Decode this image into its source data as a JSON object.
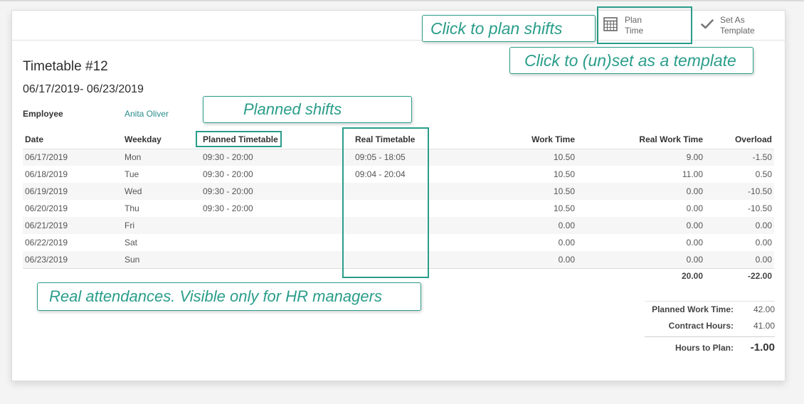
{
  "buttons": {
    "plan_time": {
      "line1": "Plan",
      "line2": "Time",
      "icon": "calendar-icon"
    },
    "set_template": {
      "line1": "Set As",
      "line2": "Template",
      "icon": "check-icon"
    }
  },
  "form": {
    "title": "Timetable #12",
    "period": "06/17/2019- 06/23/2019",
    "employee_label": "Employee",
    "employee_value": "Anita Oliver"
  },
  "table": {
    "columns": [
      "Date",
      "Weekday",
      "Planned Timetable",
      "Real Timetable",
      "Work Time",
      "Real Work Time",
      "Overload"
    ],
    "rows": [
      [
        "06/17/2019",
        "Mon",
        "09:30 - 20:00",
        "09:05 - 18:05",
        "10.50",
        "9.00",
        "-1.50"
      ],
      [
        "06/18/2019",
        "Tue",
        "09:30 - 20:00",
        "09:04 - 20:04",
        "10.50",
        "11.00",
        "0.50"
      ],
      [
        "06/19/2019",
        "Wed",
        "09:30 - 20:00",
        "",
        "10.50",
        "0.00",
        "-10.50"
      ],
      [
        "06/20/2019",
        "Thu",
        "09:30 - 20:00",
        "",
        "10.50",
        "0.00",
        "-10.50"
      ],
      [
        "06/21/2019",
        "Fri",
        "",
        "",
        "0.00",
        "0.00",
        "0.00"
      ],
      [
        "06/22/2019",
        "Sat",
        "",
        "",
        "0.00",
        "0.00",
        "0.00"
      ],
      [
        "06/23/2019",
        "Sun",
        "",
        "",
        "0.00",
        "0.00",
        "0.00"
      ]
    ],
    "totals": {
      "real_work_time": "20.00",
      "overload": "-22.00"
    }
  },
  "summary": {
    "planned_work_time_label": "Planned Work Time:",
    "planned_work_time": "42.00",
    "contract_hours_label": "Contract Hours:",
    "contract_hours": "41.00",
    "hours_to_plan_label": "Hours to Plan:",
    "hours_to_plan": "-1.00"
  },
  "callouts": {
    "plan_shifts": "Click to plan shifts",
    "template": "Click to (un)set as a template",
    "planned": "Planned shifts",
    "real": "Real attendances. Visible only for HR managers"
  },
  "colors": {
    "accent": "#2a9d8a",
    "link": "#2b8b8b"
  }
}
